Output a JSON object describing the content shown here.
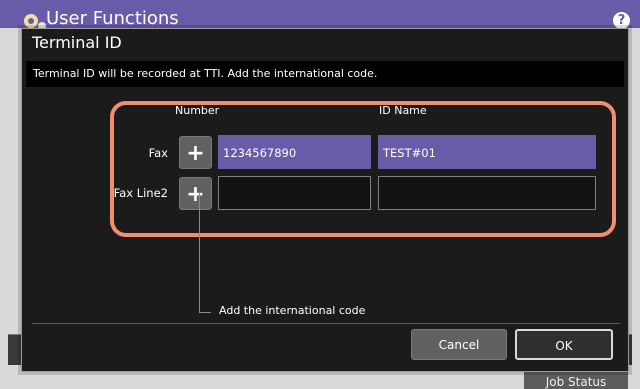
{
  "app": {
    "title": "User Functions",
    "help_label": "?",
    "job_status_label": "Job Status"
  },
  "dialog": {
    "title": "Terminal ID",
    "info": "Terminal ID will be recorded at TTI. Add the international code.",
    "columns": {
      "number": "Number",
      "id_name": "ID Name"
    },
    "rows": [
      {
        "label": "Fax",
        "number": "1234567890",
        "id_name": "TEST#01"
      },
      {
        "label": "Fax Line2",
        "number": "",
        "id_name": ""
      }
    ],
    "plus_label": "+",
    "guide_text": "Add the international code",
    "cancel_label": "Cancel",
    "ok_label": "OK"
  },
  "colors": {
    "brand_purple": "#6a5ba8",
    "highlight": "#f08e70"
  },
  "icons": [
    "gear-icon",
    "help-icon",
    "plus-icon"
  ]
}
